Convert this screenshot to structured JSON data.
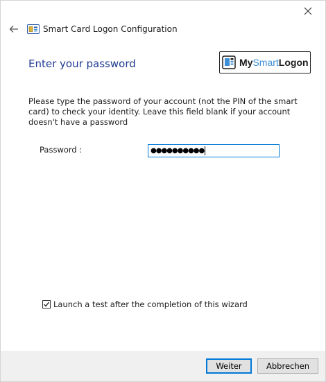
{
  "window": {
    "title": "Smart Card Logon Configuration"
  },
  "page": {
    "title": "Enter your password",
    "instructions": "Please type the password of your account (not the PIN of the smart card) to check your identity. Leave this field blank if your account doesn't have a password"
  },
  "logo": {
    "my": "My",
    "smart": "Smart",
    "logon": "Logon"
  },
  "password": {
    "label": "Password :",
    "masked_value": "●●●●●●●●●●"
  },
  "options": {
    "launch_test_label": "Launch a test after the completion of this wizard",
    "launch_test_checked": true
  },
  "footer": {
    "next_label": "Weiter",
    "cancel_label": "Abbrechen"
  },
  "colors": {
    "title_blue": "#1f3a93",
    "focus_blue": "#0078d7",
    "logo_blue": "#3d8fd6"
  }
}
